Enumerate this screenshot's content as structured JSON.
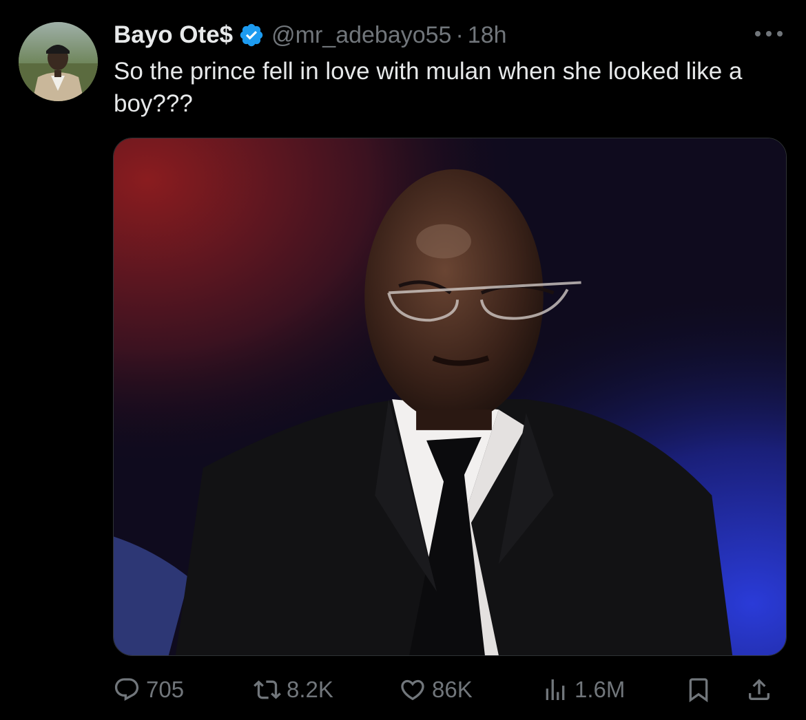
{
  "author": {
    "display_name": "Bayo Ote$",
    "handle": "@mr_adebayo55",
    "separator": "·",
    "time": "18h",
    "verified": true,
    "avatar_icon": "user-avatar"
  },
  "tweet": {
    "text": "So the prince fell in love with mulan when she looked like a boy???",
    "media_icon": "video-frame-man-in-suit"
  },
  "actions": {
    "reply_count": "705",
    "retweet_count": "8.2K",
    "like_count": "86K",
    "views_count": "1.6M"
  },
  "icons": {
    "more": "more-dots-icon",
    "reply": "reply-icon",
    "retweet": "retweet-icon",
    "like": "heart-icon",
    "views": "views-chart-icon",
    "bookmark": "bookmark-icon",
    "share": "share-icon",
    "verified": "verified-badge-icon"
  },
  "colors": {
    "background": "#000000",
    "text": "#e7e9ea",
    "muted": "#71767b",
    "verified_blue": "#1d9bf0"
  }
}
